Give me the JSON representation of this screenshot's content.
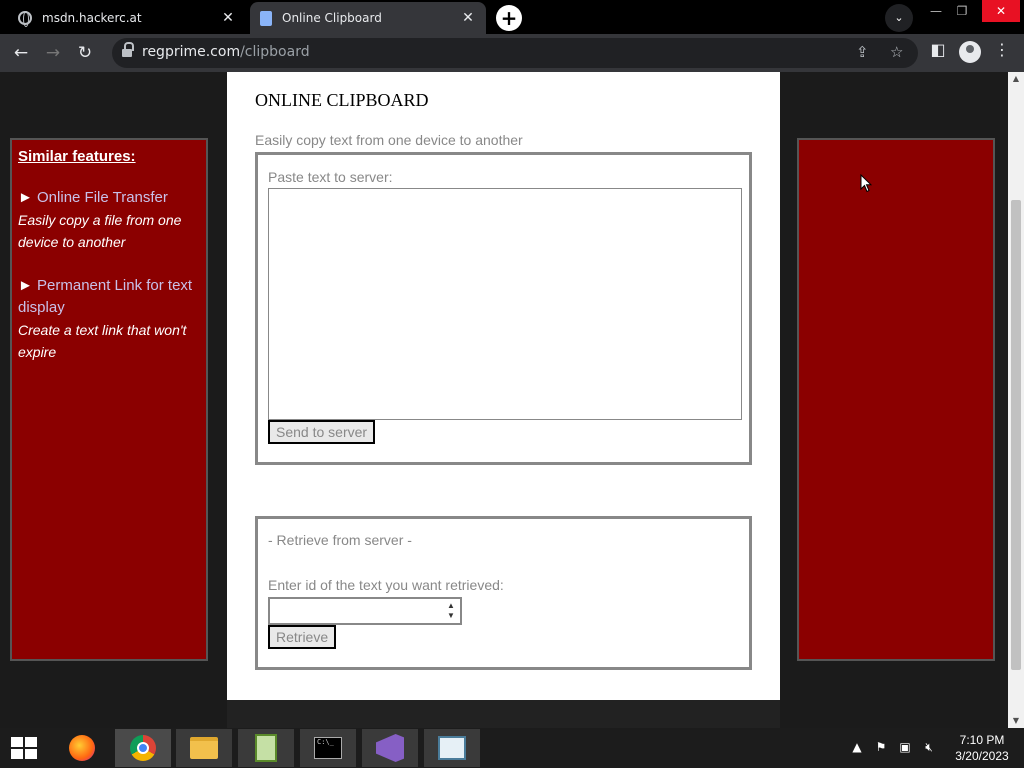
{
  "tabs": [
    {
      "title": "msdn.hackerc.at",
      "active": false
    },
    {
      "title": "Online Clipboard",
      "active": true
    }
  ],
  "omnibox": {
    "host": "regprime.com",
    "path": "/clipboard"
  },
  "sidebar": {
    "title": "Similar features:",
    "items": [
      {
        "link": "Online File Transfer",
        "desc": "Easily copy a file from one device to another"
      },
      {
        "link": "Permanent Link for text display",
        "desc": "Create a text link that won't expire"
      }
    ]
  },
  "main": {
    "title": "ONLINE CLIPBOARD",
    "tagline": "Easily copy text from one device to another",
    "paste": {
      "label": "Paste text to server:",
      "value": "",
      "button": "Send to server"
    },
    "retrieve": {
      "header": "- Retrieve from server -",
      "label": "Enter id of the text you want retrieved:",
      "value": "",
      "button": "Retrieve"
    }
  },
  "taskbar": {
    "apps": [
      "firefox",
      "chrome",
      "file-explorer",
      "notepad-plus-plus",
      "command-prompt",
      "visual-studio",
      "app"
    ],
    "clock": {
      "time": "7:10 PM",
      "date": "3/20/2023"
    }
  },
  "colors": {
    "panel_red": "#8b0000",
    "link": "#c9c0e8",
    "muted_text": "#888888"
  }
}
